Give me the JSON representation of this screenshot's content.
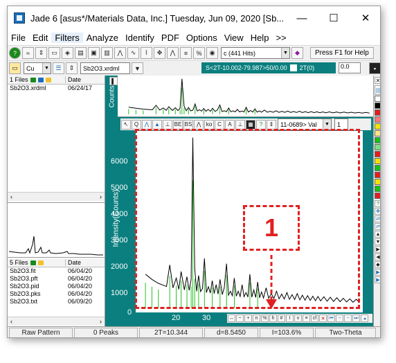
{
  "window": {
    "title": "Jade 6 [asus*/Materials Data, Inc.] Tuesday, Jun 09, 2020 [Sb...",
    "minimize": "—",
    "maximize": "☐",
    "close": "✕"
  },
  "menu": [
    "File",
    "Edit",
    "Filters",
    "Analyze",
    "Identify",
    "PDF",
    "Options",
    "View",
    "Help",
    ">>"
  ],
  "toolbar1": {
    "hits_combo": "c (441 Hits)",
    "press_f1": "Press F1 for Help"
  },
  "toolbar2": {
    "element_combo": "Cu",
    "file_combo": "Sb2O3.xrdml",
    "range_text": "S<2T-10.002-79.987>50/0.00",
    "range_value": "2T(0)",
    "value_box": "0.0"
  },
  "file_list": {
    "header": "1 Files",
    "date_header": "Date",
    "rows": [
      {
        "name": "Sb2O3.xrdml",
        "date": "06/24/17"
      }
    ]
  },
  "files_list2": {
    "header": "5 Files",
    "date_header": "Date",
    "rows": [
      {
        "name": "Sb2O3.fit",
        "date": "06/04/20"
      },
      {
        "name": "Sb2O3.pft",
        "date": "06/04/20"
      },
      {
        "name": "Sb2O3.pid",
        "date": "06/04/20"
      },
      {
        "name": "Sb2O3.pks",
        "date": "06/04/20"
      },
      {
        "name": "Sb2O3.txt",
        "date": "06/09/20"
      }
    ]
  },
  "overview": {
    "ylabel": "Counts"
  },
  "plot_toolbar": {
    "pdf_combo": "11-0689> Val",
    "count": "1"
  },
  "main_plot": {
    "ylabel": "Intensity(Counts)",
    "yticks": [
      "6000",
      "5000",
      "4000",
      "3000",
      "2000",
      "1000",
      "0"
    ],
    "xticks": [
      "20",
      "30"
    ]
  },
  "chart_data": {
    "type": "line",
    "xlabel": "",
    "ylabel": "Intensity(Counts)",
    "xlim": [
      10,
      80
    ],
    "ylim": [
      0,
      6600
    ],
    "series": [
      {
        "x": [
          13,
          15,
          17,
          18.5,
          19.5,
          20.5,
          21.5,
          22.5,
          23.3,
          24,
          25,
          25.8,
          26.5,
          27.1,
          27.6,
          28.2,
          28.8,
          29.4,
          30,
          30.6,
          31.2,
          31.8,
          32.4,
          33,
          33.6,
          34.2,
          34.8,
          35.4,
          36,
          36.7,
          37.3,
          38,
          38.6,
          39.2,
          39.8,
          40.4,
          41,
          41.6,
          42.2,
          42.8,
          43.4,
          44,
          44.6,
          45.2,
          45.8,
          46.4,
          47,
          47.6,
          48.2,
          48.8,
          49.4,
          50.2,
          51,
          51.8,
          52.6,
          53.4,
          54.2,
          55,
          55.8,
          56.6,
          57.4,
          58.2,
          59,
          59.8,
          60.6,
          61.4,
          62.2,
          63,
          63.8,
          64.6,
          65.4,
          66.2,
          67,
          68,
          69,
          70,
          71,
          72,
          73,
          74,
          75,
          76,
          77,
          78,
          79
        ],
        "y": [
          1300,
          1100,
          950,
          880,
          830,
          1650,
          780,
          1150,
          720,
          1400,
          700,
          1200,
          680,
          1100,
          6500,
          1500,
          650,
          1250,
          640,
          750,
          1900,
          600,
          820,
          580,
          1050,
          560,
          900,
          540,
          1100,
          520,
          780,
          1700,
          500,
          650,
          480,
          1150,
          460,
          650,
          450,
          900,
          440,
          600,
          430,
          1300,
          420,
          700,
          410,
          1000,
          400,
          620,
          390,
          780,
          380,
          560,
          370,
          650,
          360,
          540,
          350,
          600,
          340,
          520,
          330,
          560,
          320,
          500,
          310,
          480,
          300,
          460,
          290,
          450,
          280,
          440,
          270,
          420,
          260,
          400,
          250,
          380,
          240,
          360,
          230,
          340,
          220
        ]
      }
    ]
  },
  "status": {
    "pattern": "Raw Pattern",
    "peaks": "0 Peaks",
    "two_theta": "2T=10.344",
    "d_value": "d=8.5450",
    "intensity": "I=103.6%",
    "mode": "Two-Theta"
  },
  "annotation": {
    "label": "1",
    "color": "#e02020"
  }
}
